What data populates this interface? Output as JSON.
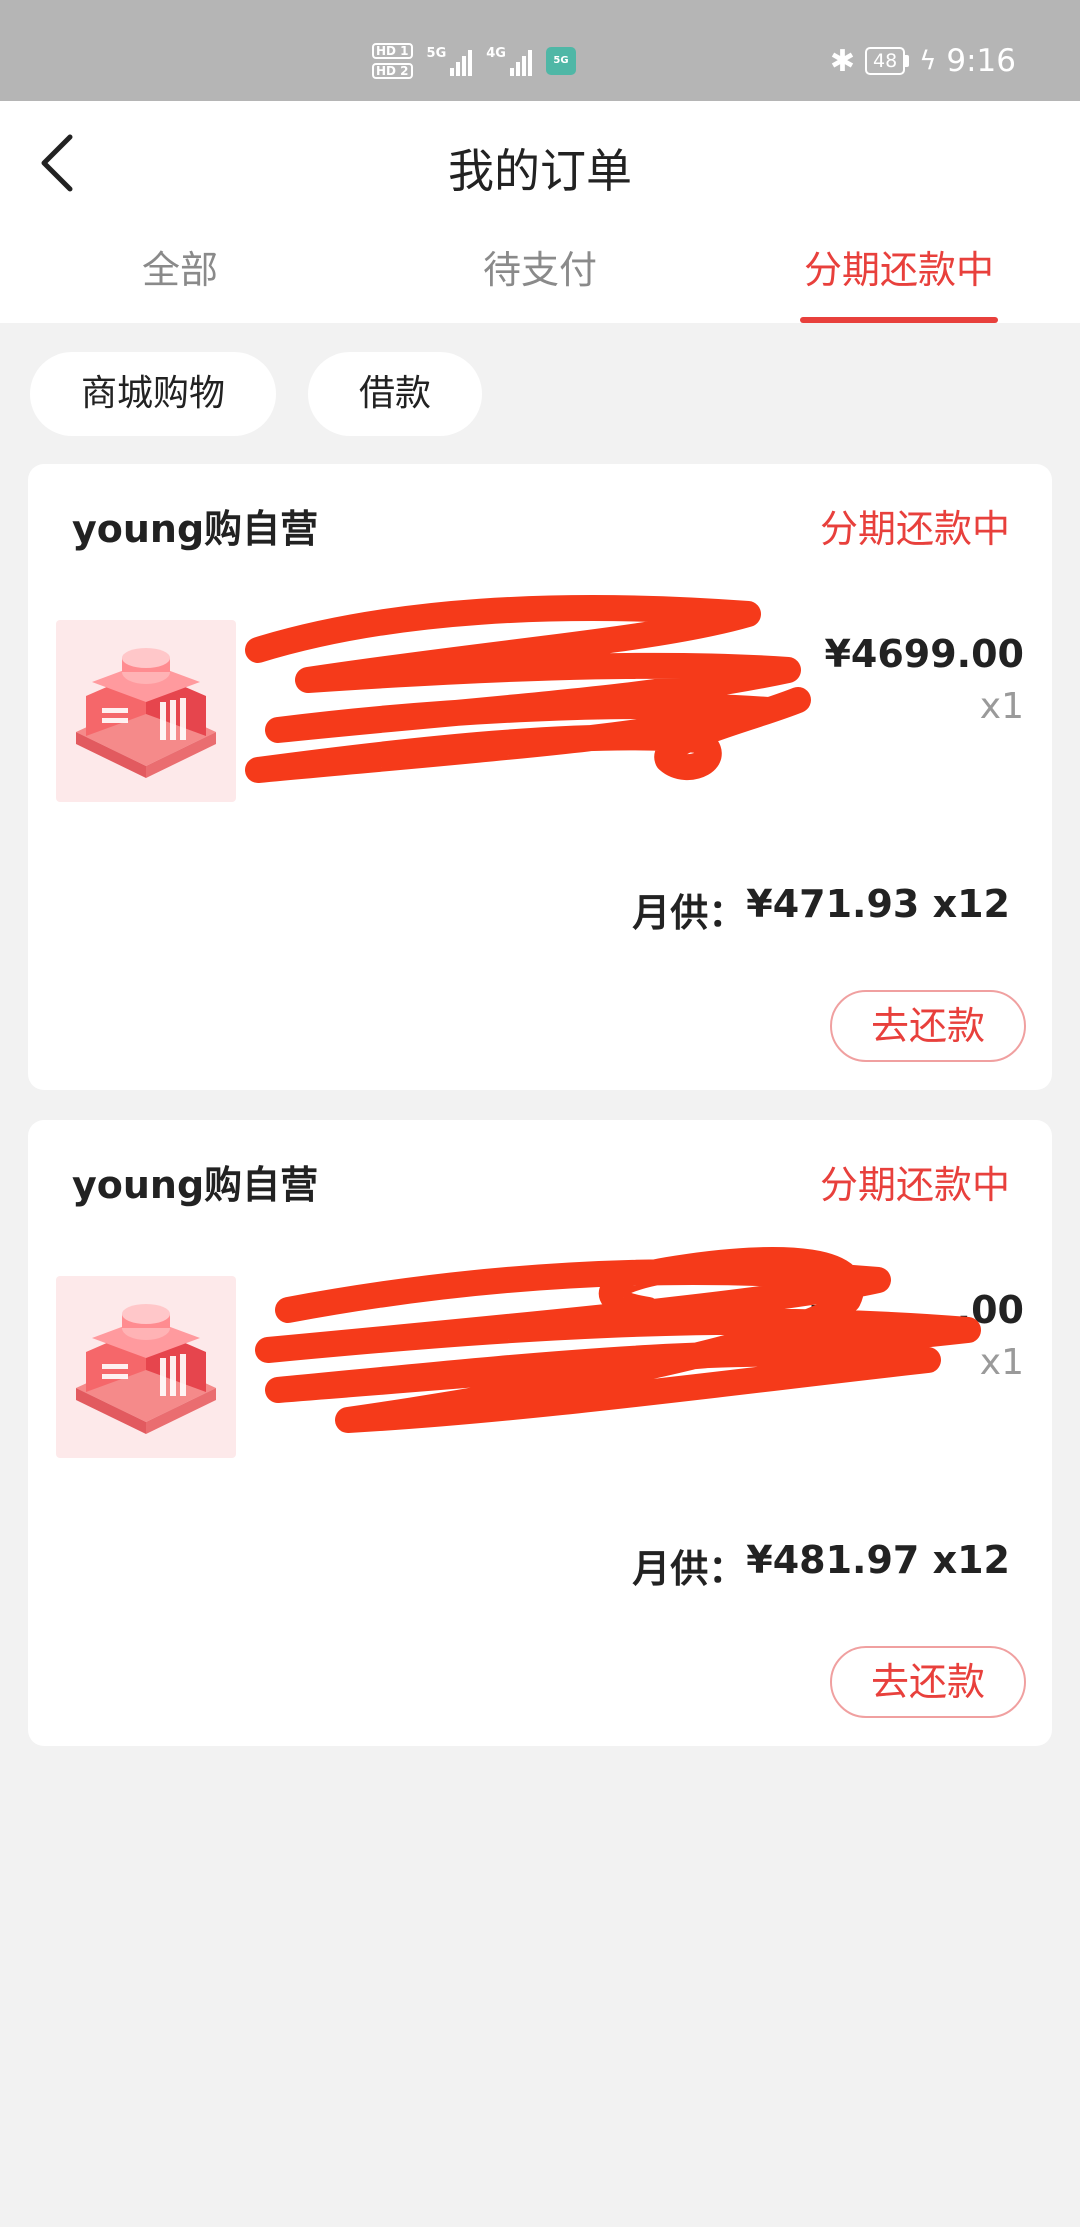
{
  "status_bar": {
    "sim1": "HD 1",
    "sim2": "HD 2",
    "net1": "5G",
    "net2": "4G",
    "app_badge": "5G",
    "battery": "48",
    "time": "9:16",
    "icons": [
      "bluetooth-icon",
      "battery-icon",
      "charging-icon"
    ]
  },
  "header": {
    "title": "我的订单",
    "back_icon": "chevron-left-icon"
  },
  "tabs": [
    {
      "label": "全部"
    },
    {
      "label": "待支付"
    },
    {
      "label": "分期还款中"
    }
  ],
  "active_tab": 2,
  "filters": [
    {
      "label": "商城购物"
    },
    {
      "label": "借款"
    }
  ],
  "orders": [
    {
      "shop": "young购自营",
      "status": "分期还款中",
      "price": "¥4699.00",
      "qty": "x1",
      "monthly_label": "月供：",
      "monthly_value": "¥471.93 x12",
      "action": "去还款"
    },
    {
      "shop": "young购自营",
      "status": "分期还款中",
      "price": "¥",
      "price_visible_tail": ".00",
      "qty": "x1",
      "monthly_label": "月供：",
      "monthly_value": "¥481.97 x12",
      "action": "去还款"
    }
  ],
  "colors": {
    "accent": "#e8403c",
    "scribble": "#f53a1a",
    "background": "#f2f2f2",
    "statusbar": "#b5b5b5"
  }
}
